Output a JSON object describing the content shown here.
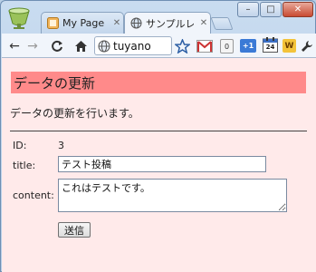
{
  "browser": {
    "tabs": [
      {
        "label": "My Page",
        "active": false
      },
      {
        "label": "サンプルレ",
        "active": true
      }
    ],
    "window_controls": {
      "minimize": "–",
      "maximize": "□",
      "close": "✕"
    },
    "address": "tuyano",
    "extensions": {
      "badge_zero": "0",
      "badge_plus1": "+1",
      "calendar_day": "24",
      "w_label": "W"
    }
  },
  "page": {
    "heading": "データの更新",
    "description": "データの更新を行います。",
    "form": {
      "id_label": "ID:",
      "id_value": "3",
      "title_label": "title:",
      "title_value": "テスト投稿",
      "content_label": "content:",
      "content_value": "これはテストです。",
      "submit_label": "送信"
    }
  },
  "colors": {
    "heading_bg": "#ff8a8a",
    "page_bg": "#ffeaea"
  }
}
